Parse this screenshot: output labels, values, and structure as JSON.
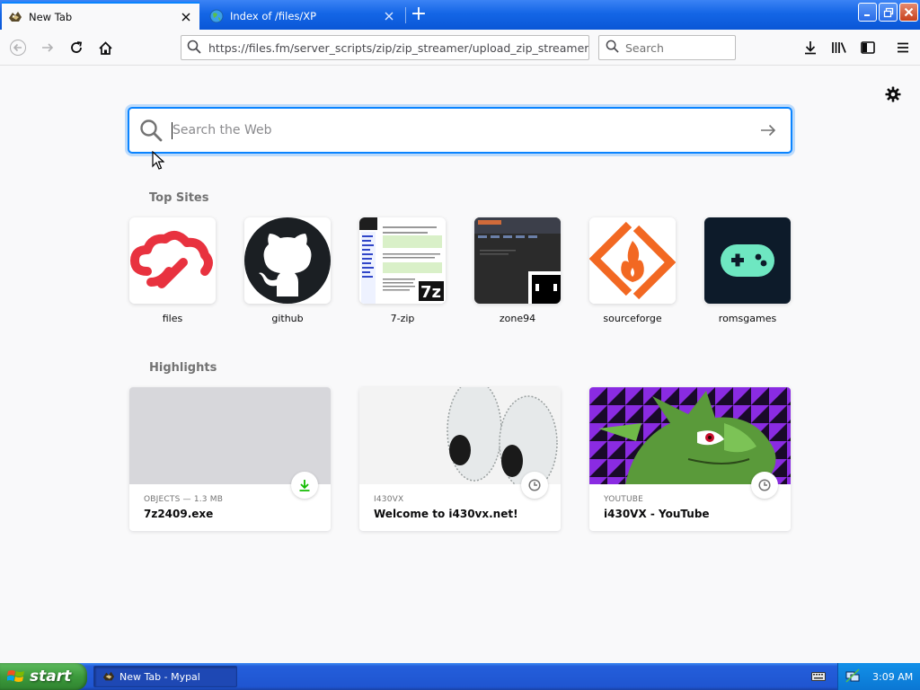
{
  "browser": {
    "tabs": [
      {
        "title": "New Tab",
        "active": true,
        "favicon": "mypal-icon"
      },
      {
        "title": "Index of /files/XP",
        "active": false,
        "favicon": "globe-icon"
      }
    ],
    "new_tab_label": "+",
    "url": "https://files.fm/server_scripts/zip/zip_streamer/upload_zip_streamer",
    "search_placeholder": "Search",
    "accent": "#0a84ff"
  },
  "newtab": {
    "search_placeholder": "Search the Web",
    "top_sites_title": "Top Sites",
    "top_sites": [
      {
        "label": "files",
        "icon": "files-cloud-icon",
        "color": "#e8323f"
      },
      {
        "label": "github",
        "icon": "github-icon",
        "color": "#1b1f23"
      },
      {
        "label": "7-zip",
        "icon": "7zip-thumbnail"
      },
      {
        "label": "zone94",
        "icon": "zone94-thumbnail"
      },
      {
        "label": "sourceforge",
        "icon": "sourceforge-icon",
        "color": "#f26822"
      },
      {
        "label": "romsgames",
        "icon": "gamepad-icon",
        "color": "#6ee7c1"
      }
    ],
    "highlights_title": "Highlights",
    "highlights": [
      {
        "meta": "OBJECTS — 1.3 MB",
        "title": "7z2409.exe",
        "badge": "download-icon"
      },
      {
        "meta": "I430VX",
        "title": "Welcome to i430vx.net!",
        "badge": "clock-icon"
      },
      {
        "meta": "YOUTUBE",
        "title": "i430VX - YouTube",
        "badge": "clock-icon"
      }
    ]
  },
  "taskbar": {
    "start_label": "start",
    "task_item": "New Tab - Mypal",
    "clock": "3:09 AM"
  }
}
